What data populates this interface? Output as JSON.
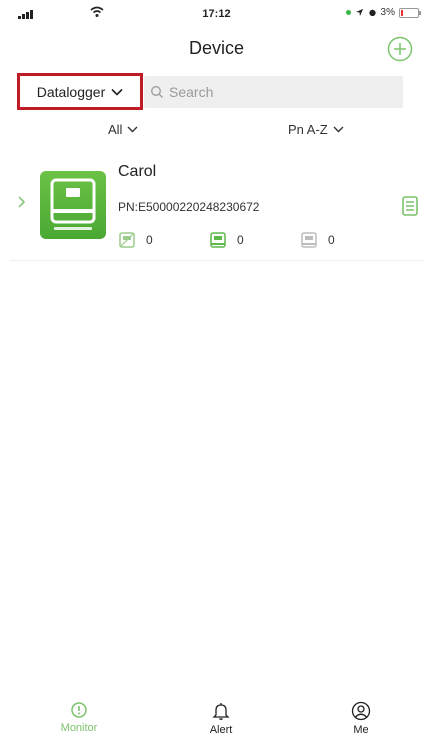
{
  "status_bar": {
    "time": "17:12",
    "battery": "3%"
  },
  "header": {
    "title": "Device"
  },
  "filter": {
    "type_select": "Datalogger",
    "search_placeholder": "Search"
  },
  "sort": {
    "status": "All",
    "order": "Pn A-Z"
  },
  "devices": [
    {
      "name": "Carol",
      "pn": "PN:E50000220248230672",
      "stats": [
        {
          "value": "0"
        },
        {
          "value": "0"
        },
        {
          "value": "0"
        }
      ]
    }
  ],
  "tabs": [
    {
      "label": "Monitor"
    },
    {
      "label": "Alert"
    },
    {
      "label": "Me"
    }
  ],
  "colors": {
    "accent": "#7cc36c",
    "highlight_border": "#c01a24"
  }
}
